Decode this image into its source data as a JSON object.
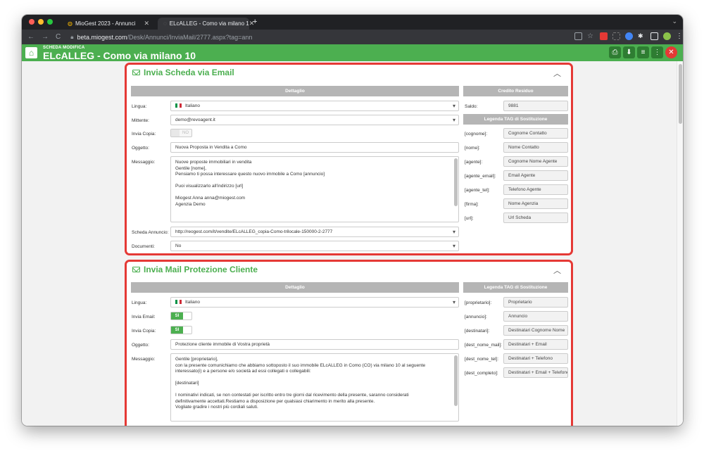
{
  "browser": {
    "tabs": [
      {
        "label": "MioGest 2023 - Annunci"
      },
      {
        "label": "ELcALLEG - Como via milano 1"
      }
    ],
    "url_host": "beta.miogest.com",
    "url_path": "/Desk/Annunci/InviaMail/2777.aspx?tag=ann"
  },
  "header": {
    "subtitle": "SCHEDA MODIFICA",
    "title": "ELcALLEG - Como via milano 10"
  },
  "panel1": {
    "title": "Invia Scheda via Email",
    "detail_header": "Dettaglio",
    "credit_header": "Credito Residuo",
    "legend_header": "Legenda TAG di Sostituzione",
    "lingua_label": "Lingua:",
    "lingua_value": "Italiano",
    "mittente_label": "Mittente:",
    "mittente_value": "demo@revoagent.it",
    "copia_label": "Invia Copia:",
    "copia_value": "NO",
    "oggetto_label": "Oggetto:",
    "oggetto_value": "Nuova Proposta in Vendita a Como",
    "messaggio_label": "Messaggio:",
    "messaggio_lines": [
      "Nuove proposte immobiliari in vendita",
      "Gentile [nome],",
      "Pensiamo ti possa interessare questo nuovo immobile a Como  [annuncio]",
      "",
      "Puoi visualizzarlo all'indirizzo [url]",
      "",
      "Miogest Anna anna@miogest.com",
      "Agenzia Demo"
    ],
    "scheda_label": "Scheda Annuncio:",
    "scheda_value": "http://reogest.com/it/vendite/ELcALLEG_copia-Como-trilocale-150000-2-2777",
    "documenti_label": "Documenti:",
    "documenti_value": "No",
    "saldo_label": "Saldo:",
    "saldo_value": "9881",
    "tags": [
      {
        "tag": "[cognome]:",
        "value": "Cognome Contatto"
      },
      {
        "tag": "[nome]:",
        "value": "Nome Contatto"
      },
      {
        "tag": "[agente]:",
        "value": "Cognome Nome Agente"
      },
      {
        "tag": "[agente_email]:",
        "value": "Email Agente"
      },
      {
        "tag": "[agente_tel]:",
        "value": "Telefono Agente"
      },
      {
        "tag": "[firma]:",
        "value": "Nome Agenzia"
      },
      {
        "tag": "[url]:",
        "value": "Url Scheda"
      }
    ]
  },
  "panel2": {
    "title": "Invia Mail Protezione Cliente",
    "detail_header": "Dettaglio",
    "legend_header": "Legenda TAG di Sostituzione",
    "lingua_label": "Lingua:",
    "lingua_value": "Italiano",
    "email_label": "Invia Email:",
    "email_value": "SI",
    "copia_label": "Invia Copia:",
    "copia_value": "SI",
    "oggetto_label": "Oggetto:",
    "oggetto_value": "Protezione cliente immobile di Vostra proprietà",
    "messaggio_label": "Messaggio:",
    "messaggio_lines": [
      "Gentile [proprietario],",
      "con la presente comunichiamo che abbiamo sottoposto il suo immobile ELcALLEG in Como (CO) via milano 10 al seguente",
      "interessato(i) e a persone e/o società ad essi collegati o collegabili:",
      "",
      "[destinatari]",
      "",
      "I nominativi indicati, se non contestati per iscritto entro tre giorni dal ricevimento della presente, saranno considerati",
      "definitivamente accettati.Restiamo a disposizione per qualsiasi chiarimento in merito alla presente.",
      "Vogliate gradire i nostri più cordiali saluti."
    ],
    "tags": [
      {
        "tag": "[proprietario]:",
        "value": "Proprietario"
      },
      {
        "tag": "[annuncio]:",
        "value": "Annuncio"
      },
      {
        "tag": "[destinatari]:",
        "value": "Destinatari Cognome Nome"
      },
      {
        "tag": "[dest_nome_mail]:",
        "value": "Destinatari + Email"
      },
      {
        "tag": "[dest_nome_tel]:",
        "value": "Destinatari + Telefono"
      },
      {
        "tag": "[dest_completo]:",
        "value": "Destinatari + Email + Telefono"
      }
    ]
  }
}
